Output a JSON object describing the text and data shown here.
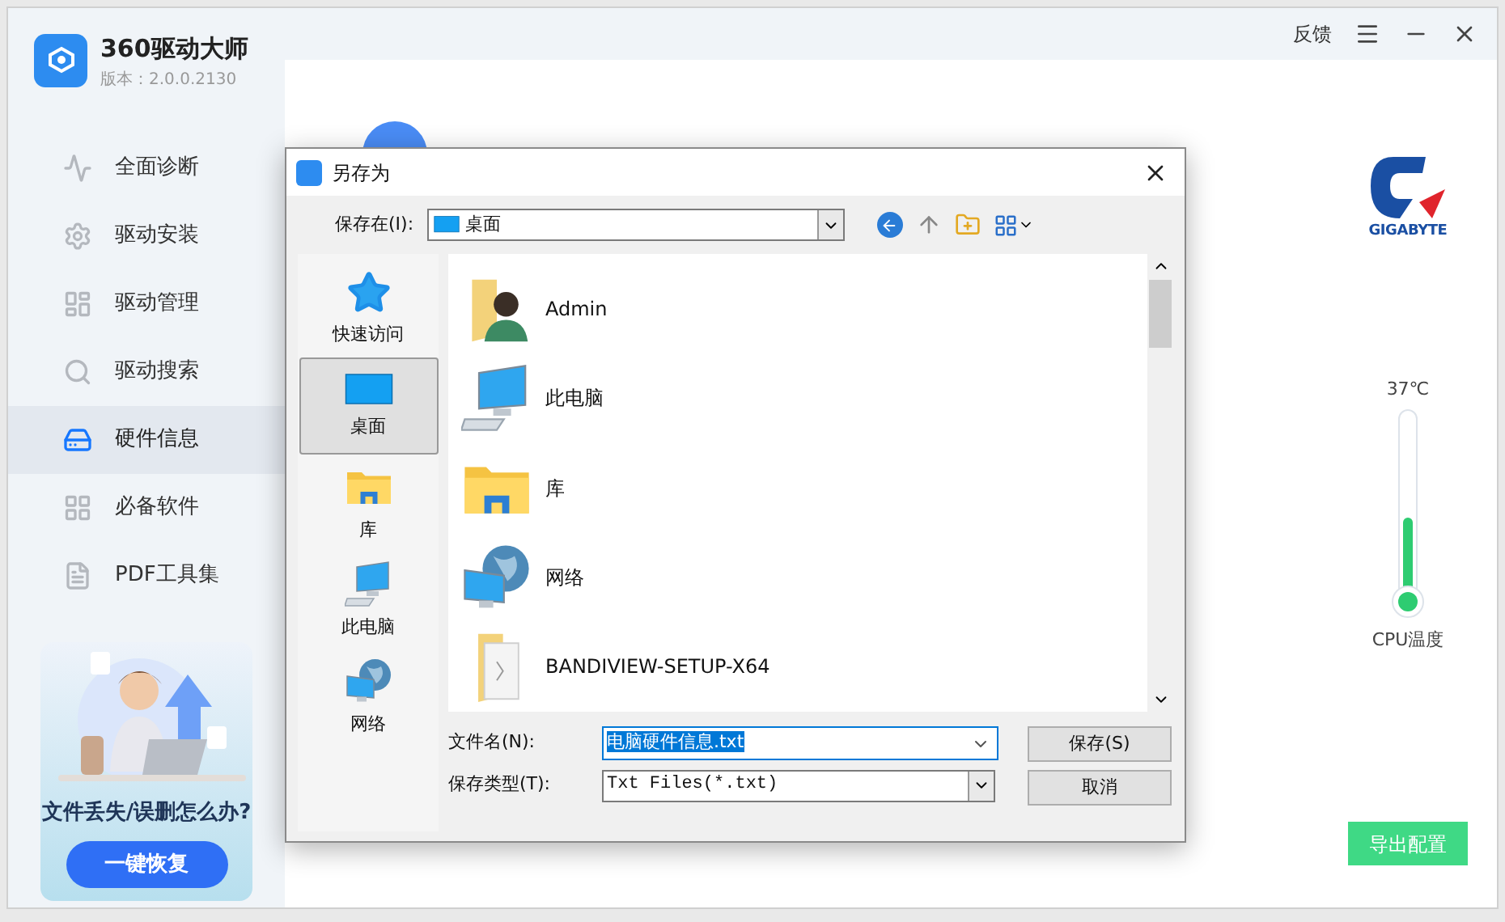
{
  "app": {
    "name": "360驱动大师",
    "version": "版本：2.0.0.2130"
  },
  "sidebar": {
    "items": [
      {
        "label": "全面诊断",
        "kind": "diagnose",
        "selected": false
      },
      {
        "label": "驱动安装",
        "kind": "install",
        "selected": false
      },
      {
        "label": "驱动管理",
        "kind": "manage",
        "selected": false
      },
      {
        "label": "驱动搜索",
        "kind": "search",
        "selected": false
      },
      {
        "label": "硬件信息",
        "kind": "hardware",
        "selected": true
      },
      {
        "label": "必备软件",
        "kind": "software",
        "selected": false
      },
      {
        "label": "PDF工具集",
        "kind": "pdf",
        "selected": false
      }
    ]
  },
  "promo": {
    "title": "文件丢失/误删怎么办?",
    "button": "一键恢复"
  },
  "top_bar": {
    "feedback": "反馈"
  },
  "brand": {
    "logo_text": "GIGABYTE"
  },
  "cpu_temp": {
    "reading": "37℃",
    "level": 0.4,
    "label": "CPU温度"
  },
  "export_button": "导出配置",
  "dialog": {
    "title": "另存为",
    "save_in": {
      "label": "保存在(I):",
      "value": "桌面"
    },
    "places": [
      {
        "label": "快速访问",
        "kind": "star",
        "selected": false
      },
      {
        "label": "桌面",
        "kind": "desktop",
        "selected": true
      },
      {
        "label": "库",
        "kind": "library",
        "selected": false
      },
      {
        "label": "此电脑",
        "kind": "computer",
        "selected": false
      },
      {
        "label": "网络",
        "kind": "network",
        "selected": false
      }
    ],
    "files": [
      {
        "name": "Admin",
        "kind": "user"
      },
      {
        "name": "此电脑",
        "kind": "computer"
      },
      {
        "name": "库",
        "kind": "library"
      },
      {
        "name": "网络",
        "kind": "network"
      },
      {
        "name": "BANDIVIEW-SETUP-X64",
        "kind": "zip"
      }
    ],
    "filename": {
      "label": "文件名(N):",
      "value": "电脑硬件信息.txt",
      "text_selected": true
    },
    "filetype": {
      "label": "保存类型(T):",
      "value": "Txt Files(*.txt)"
    },
    "buttons": [
      "保存(S)",
      "取消"
    ]
  }
}
